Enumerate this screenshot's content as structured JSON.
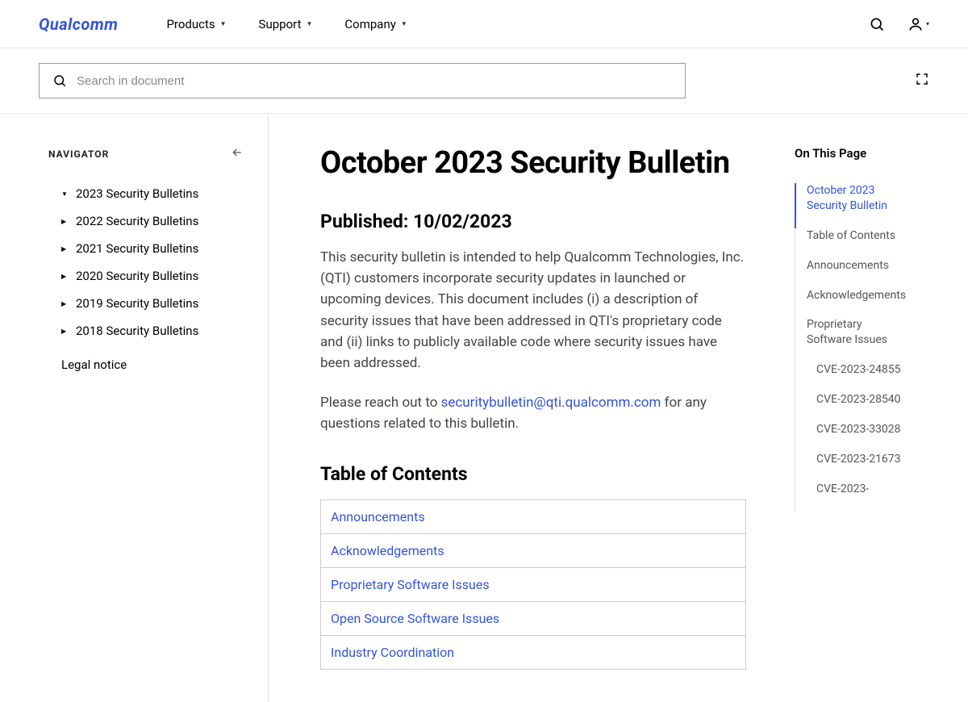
{
  "brand": "Qualcomm",
  "nav": {
    "products": "Products",
    "support": "Support",
    "company": "Company"
  },
  "docSearch": {
    "placeholder": "Search in document"
  },
  "sidebar": {
    "title": "NAVIGATOR",
    "items": [
      {
        "label": "2023 Security Bulletins",
        "open": true
      },
      {
        "label": "2022 Security Bulletins",
        "open": false
      },
      {
        "label": "2021 Security Bulletins",
        "open": false
      },
      {
        "label": "2020 Security Bulletins",
        "open": false
      },
      {
        "label": "2019 Security Bulletins",
        "open": false
      },
      {
        "label": "2018 Security Bulletins",
        "open": false
      }
    ],
    "legal": "Legal notice"
  },
  "article": {
    "title": "October 2023 Security Bulletin",
    "published": "Published: 10/02/2023",
    "p1": "This security bulletin is intended to help Qualcomm Technologies, Inc. (QTI) customers incorporate security updates in launched or upcoming devices. This document includes (i) a description of security issues that have been addressed in QTI's proprietary code and (ii) links to publicly available code where security issues have been addressed.",
    "p2a": "Please reach out to ",
    "p2link": "securitybulletin@qti.qualcomm.com",
    "p2b": " for any questions related to this bulletin.",
    "tocTitle": "Table of Contents",
    "tocItems": [
      "Announcements",
      "Acknowledgements",
      "Proprietary Software Issues",
      "Open Source Software Issues",
      "Industry Coordination"
    ]
  },
  "onpage": {
    "title": "On This Page",
    "items": [
      {
        "label": "October 2023 Security Bulletin",
        "active": true,
        "sub": false
      },
      {
        "label": "Table of Contents",
        "active": false,
        "sub": false
      },
      {
        "label": "Announcements",
        "active": false,
        "sub": false
      },
      {
        "label": "Acknowledgements",
        "active": false,
        "sub": false
      },
      {
        "label": "Proprietary Software Issues",
        "active": false,
        "sub": false
      },
      {
        "label": "CVE-2023-24855",
        "active": false,
        "sub": true
      },
      {
        "label": "CVE-2023-28540",
        "active": false,
        "sub": true
      },
      {
        "label": "CVE-2023-33028",
        "active": false,
        "sub": true
      },
      {
        "label": "CVE-2023-21673",
        "active": false,
        "sub": true
      },
      {
        "label": "CVE-2023-",
        "active": false,
        "sub": true
      }
    ]
  }
}
